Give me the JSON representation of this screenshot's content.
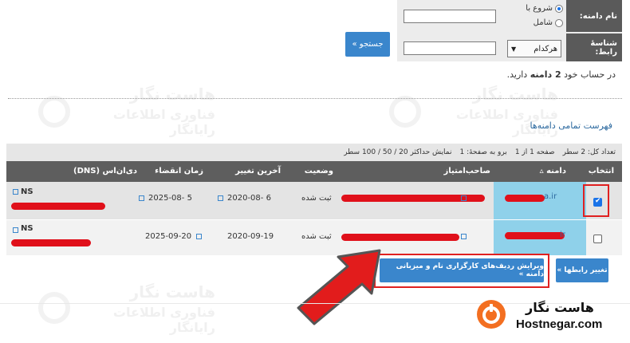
{
  "watermark": {
    "brand": "هاست نگار",
    "tagline": "فناوری اطلاعات رایانگار"
  },
  "search": {
    "domain_name_label": "نام دامنه:",
    "radio_starts_with": "شروع با",
    "radio_contains": "شامل",
    "contact_id_label": "شناسهٔ رابط:",
    "contact_select_value": "هرکدام",
    "search_button": "جستجو »"
  },
  "account_summary": {
    "prefix": "در حساب خود",
    "count": "2 دامنه",
    "suffix": "دارید."
  },
  "list_title": "فهرست تمامی دامنه‌ها",
  "pager": {
    "total": "تعداد کل: 2 سطر",
    "page": "صفحه 1 از 1",
    "go_to_page": "برو به صفحهٔ: 1",
    "show_max": "نمایش حداکثر 20 / 50 / 100 سطر"
  },
  "table": {
    "columns": {
      "select": "انتخاب",
      "domain": "دامنه ▵",
      "holder": "صاحب‌امتیاز",
      "status": "وضعیت",
      "last_change": "آخرین تغییر",
      "expiry": "زمان انقضاء",
      "dns": "دی‌ان‌اس (DNS)"
    },
    "rows": [
      {
        "checked": true,
        "domain_suffix": "a.ir",
        "status": "ثبت شده",
        "last_change": "2020-08- 6",
        "expiry": "2025-08- 5",
        "dns": "NS"
      },
      {
        "checked": false,
        "domain_suffix": "ir",
        "status": "ثبت شده",
        "last_change": "2020-09-19",
        "expiry": "2025-09-20",
        "dns": "NS"
      }
    ]
  },
  "actions": {
    "edit_records": "ویرایش ردیف‌های کارگزاری نام و میزبانی دامنه »",
    "change_contacts": "تغییر رابطها »"
  },
  "logo": {
    "fa": "هاست نگار",
    "en": "Hostnegar.com"
  },
  "colors": {
    "accent": "#3a86cc",
    "header_dark": "#5e5e5e",
    "domain_highlight": "#8fd1ea",
    "highlight_red": "#e02020",
    "logo_orange": "#f36f21"
  }
}
